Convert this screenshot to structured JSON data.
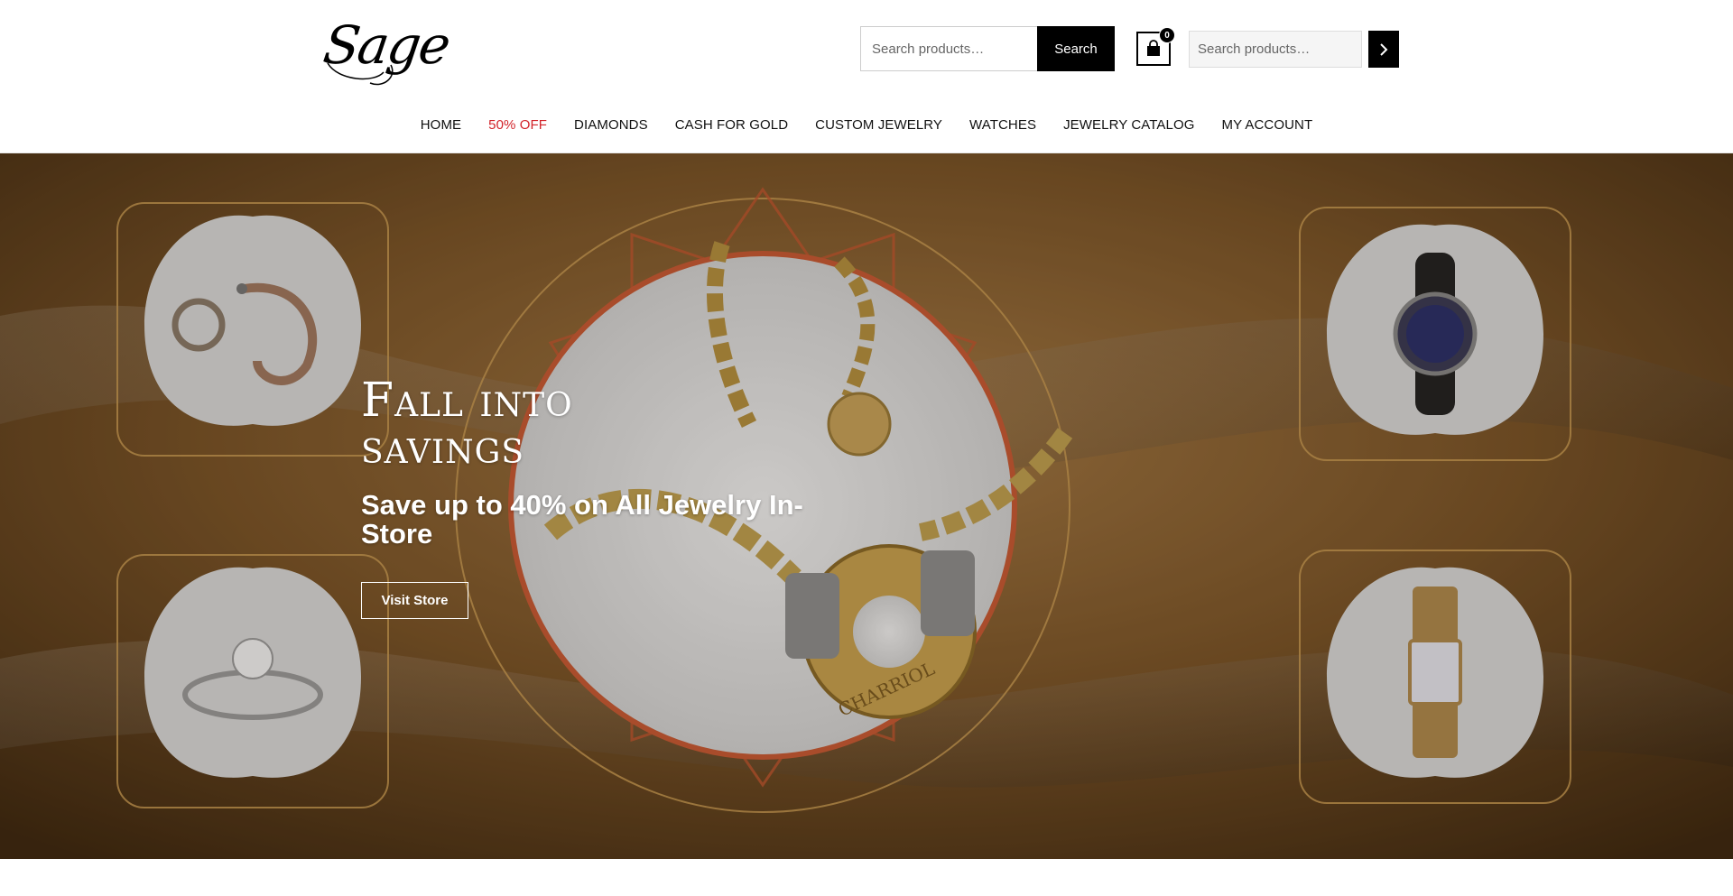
{
  "brand": {
    "logo_text": "Sage"
  },
  "header": {
    "search_primary": {
      "placeholder": "Search products…",
      "button_label": "Search"
    },
    "cart": {
      "count": "0"
    },
    "search_secondary": {
      "placeholder": "Search products…"
    }
  },
  "nav": {
    "items": [
      {
        "label": "HOME"
      },
      {
        "label": "50% OFF"
      },
      {
        "label": "DIAMONDS"
      },
      {
        "label": "CASH FOR GOLD"
      },
      {
        "label": "CUSTOM JEWELRY"
      },
      {
        "label": "WATCHES"
      },
      {
        "label": "JEWELRY CATALOG"
      },
      {
        "label": "MY ACCOUNT"
      }
    ]
  },
  "hero": {
    "title": "Fall into savings",
    "subtitle": "Save up to 40% on All Jewelry In-Store",
    "button_label": "Visit Store",
    "center_pendant_engraving": "CHARRIOL"
  },
  "colors": {
    "sale": "#d2232a",
    "button": "#000000",
    "hero_gold": "#b58a4a"
  }
}
